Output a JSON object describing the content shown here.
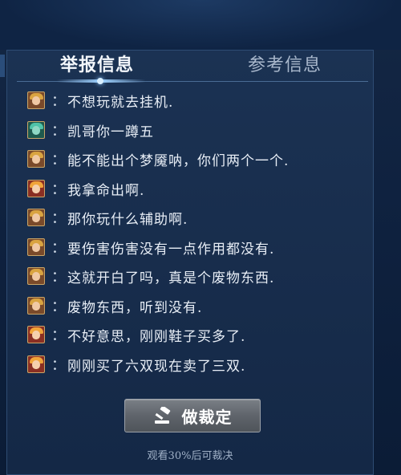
{
  "tabs": {
    "report_info": "举报信息",
    "reference_info": "参考信息"
  },
  "messages": [
    {
      "text": "不想玩就去挂机.",
      "avatar": "hero-a"
    },
    {
      "text": "凯哥你一蹲五",
      "avatar": "hero-b"
    },
    {
      "text": "能不能出个梦魇呐，你们两个一个.",
      "avatar": "hero-a"
    },
    {
      "text": "我拿命出啊.",
      "avatar": "hero-c"
    },
    {
      "text": "那你玩什么辅助啊.",
      "avatar": "hero-a"
    },
    {
      "text": "要伤害伤害没有一点作用都没有.",
      "avatar": "hero-a"
    },
    {
      "text": "这就开白了吗，真是个废物东西.",
      "avatar": "hero-a"
    },
    {
      "text": "废物东西，听到没有.",
      "avatar": "hero-a"
    },
    {
      "text": "不好意思，刚刚鞋子买多了.",
      "avatar": "hero-c"
    },
    {
      "text": "刚刚买了六双现在卖了三双.",
      "avatar": "hero-c"
    }
  ],
  "colon": "：",
  "verdict_button": {
    "label": "做裁定",
    "icon": "gavel-icon"
  },
  "hint": "观看30%后可裁决",
  "colors": {
    "panel": "#172c4b",
    "active_tab": "#f3f7fc",
    "inactive_tab": "#a9b8cc",
    "button": "#5f646b"
  }
}
